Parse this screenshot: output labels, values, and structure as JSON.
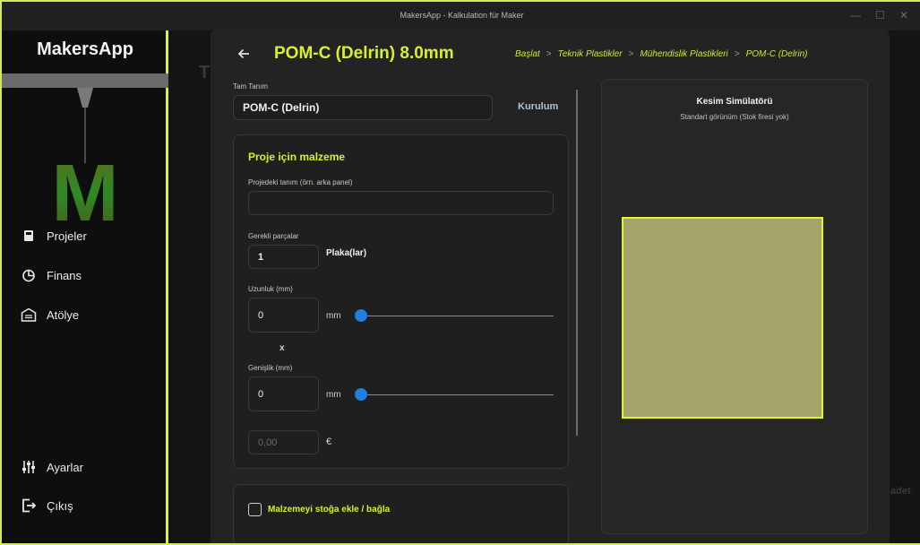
{
  "window": {
    "title": "MakersApp - Kalkulation für Maker",
    "controls": {
      "minimize": "—",
      "maximize": "☐",
      "close": "✕"
    }
  },
  "sidebar": {
    "brand": "MakersApp",
    "logo_letter": "M",
    "items": [
      {
        "label": "Projeler",
        "icon": "project-icon"
      },
      {
        "label": "Finans",
        "icon": "pie-chart-icon"
      },
      {
        "label": "Atölye",
        "icon": "garage-icon"
      },
      {
        "label": "Ayarlar",
        "icon": "sliders-icon"
      },
      {
        "label": "Çıkış",
        "icon": "logout-icon"
      }
    ]
  },
  "backdrop": {
    "heading_fragment": "T",
    "right_fragment": "adet"
  },
  "header": {
    "title": "POM-C (Delrin) 8.0mm",
    "breadcrumb": [
      "Başlat",
      "Teknik Plastikler",
      "Mühendislik Plastikleri",
      "POM-C (Delrin)"
    ],
    "breadcrumb_separator": ">"
  },
  "form": {
    "full_name_label": "Tam Tanım",
    "full_name_value": "POM-C (Delrin)",
    "setup_label": "Kurulum",
    "section_title": "Proje için malzeme",
    "project_desc_label": "Projedeki tanım (örn. arka panel)",
    "project_desc_value": "",
    "parts_label": "Gerekli parçalar",
    "parts_value": "1",
    "parts_unit": "Plaka(lar)",
    "length_label": "Uzunluk (mm)",
    "length_value": "0",
    "length_unit": "mm",
    "times_sign": "x",
    "width_label": "Genişlik (mm)",
    "width_value": "0",
    "width_unit": "mm",
    "price_placeholder": "0,00",
    "currency": "€",
    "stock_checkbox_label": "Malzemeyi stoğa ekle / bağla"
  },
  "simulator": {
    "title": "Kesim Simülatörü",
    "subtitle": "Standart görünüm (Stok firesi yok)"
  },
  "colors": {
    "accent": "#d8f02c",
    "slider": "#1f7fe0",
    "sheet": "#a3a56a"
  }
}
